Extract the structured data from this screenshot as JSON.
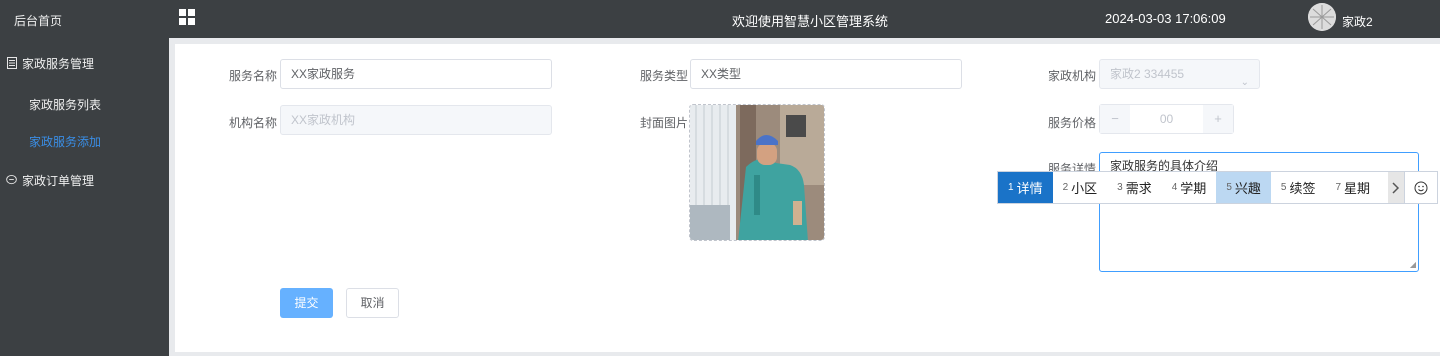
{
  "sidebar": {
    "home": "后台首页",
    "menu1": "家政服务管理",
    "sub1": "家政服务列表",
    "sub2": "家政服务添加",
    "menu2": "家政订单管理"
  },
  "header": {
    "title": "欢迎使用智慧小区管理系统",
    "datetime": "2024-03-03 17:06:09",
    "user": "家政2"
  },
  "form": {
    "service_name_label": "服务名称",
    "service_name_value": "XX家政服务",
    "service_type_label": "服务类型",
    "service_type_value": "XX类型",
    "agency_label": "家政机构",
    "agency_value": "家政2 334455",
    "org_name_label": "机构名称",
    "org_name_placeholder": "XX家政机构",
    "cover_label": "封面图片",
    "price_label": "服务价格",
    "price_value": "00",
    "detail_label": "服务详情",
    "detail_value": "家政服务的具体介绍",
    "submit": "提交",
    "cancel": "取消"
  },
  "ime": {
    "candidates": [
      {
        "num": "1",
        "text": "详情"
      },
      {
        "num": "2",
        "text": "小区"
      },
      {
        "num": "3",
        "text": "需求"
      },
      {
        "num": "4",
        "text": "学期"
      },
      {
        "num": "5",
        "text": "兴趣"
      },
      {
        "num": "5",
        "text": "续签"
      },
      {
        "num": "7",
        "text": "星期"
      }
    ]
  }
}
